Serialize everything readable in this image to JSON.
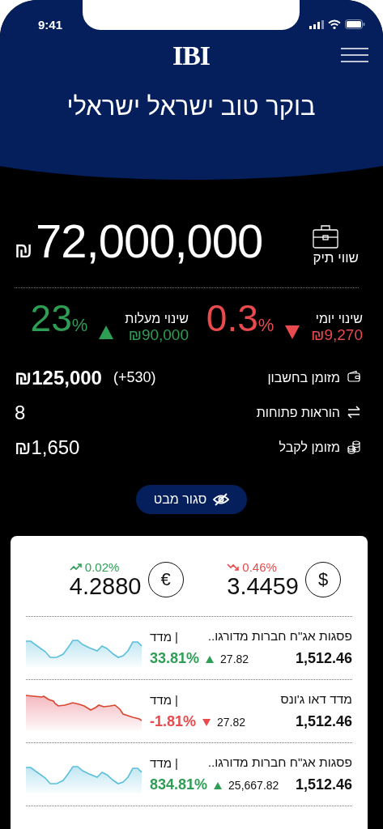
{
  "status_bar": {
    "time": "9:41"
  },
  "header": {
    "logo": "IBI",
    "greeting": "בוקר טוב ישראל ישראלי"
  },
  "portfolio": {
    "label": "שווי תיק",
    "currency": "₪",
    "value": "72,000,000"
  },
  "changes": [
    {
      "label": "שינוי יומי",
      "amount": "₪9,270",
      "percent": "0.3",
      "percent_sign": "%",
      "kind": "down"
    },
    {
      "label": "שינוי מעלות",
      "amount": "₪90,000",
      "percent": "23",
      "percent_sign": "%",
      "kind": "up"
    }
  ],
  "summary": [
    {
      "kind": "cash",
      "label": "מזומן בחשבון",
      "value": "₪125,000",
      "note": "(+530)"
    },
    {
      "kind": "orders",
      "label": "הוראות פתוחות",
      "value": "8"
    },
    {
      "kind": "receivable",
      "label": "מזומן לקבל",
      "value": "₪1,650"
    }
  ],
  "toggle_button": {
    "label": "סגור מבט"
  },
  "rates": [
    {
      "symbol": "$",
      "value": "3.4459",
      "change": "0.46%",
      "kind": "down"
    },
    {
      "symbol": "€",
      "value": "4.2880",
      "change": "0.02%",
      "kind": "up"
    }
  ],
  "indices": [
    {
      "name": "פסגות אג\"ח חברות מדורגו..",
      "tag": "| מדד",
      "value": "1,512.46",
      "change": "27.82",
      "percent": "33.81%",
      "kind": "up"
    },
    {
      "name": "מדד דאו ג'ונס",
      "tag": "| מדד",
      "value": "1,512.46",
      "change": "27.82",
      "percent": "-1.81%",
      "kind": "down"
    },
    {
      "name": "פסגות אג\"ח חברות מדורגו..",
      "tag": "| מדד",
      "value": "1,512.46",
      "change": "25,667.82",
      "percent": "834.81%",
      "kind": "up"
    }
  ]
}
